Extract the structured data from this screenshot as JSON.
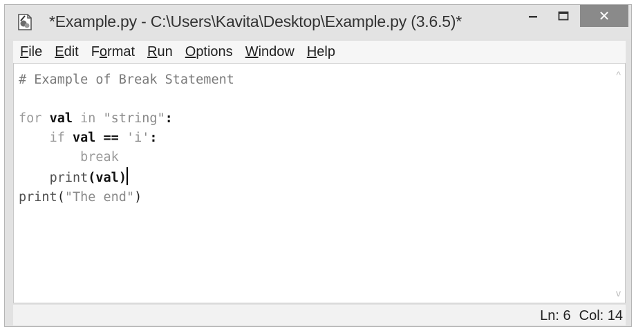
{
  "window": {
    "title": "*Example.py - C:\\Users\\Kavita\\Desktop\\Example.py (3.6.5)*",
    "app_icon": "idle-python-icon",
    "controls": {
      "minimize": "–",
      "maximize": "☐",
      "close": "✕"
    }
  },
  "menu": [
    {
      "pre": "",
      "u": "F",
      "post": "ile"
    },
    {
      "pre": "",
      "u": "E",
      "post": "dit"
    },
    {
      "pre": "F",
      "u": "o",
      "post": "rmat"
    },
    {
      "pre": "",
      "u": "R",
      "post": "un"
    },
    {
      "pre": "",
      "u": "O",
      "post": "ptions"
    },
    {
      "pre": "",
      "u": "W",
      "post": "indow"
    },
    {
      "pre": "",
      "u": "H",
      "post": "elp"
    }
  ],
  "editor": {
    "line1": "# Example of Break Statement",
    "line3": {
      "kw_for": "for",
      "var": "val",
      "kw_in": "in",
      "str": "\"string\"",
      "colon": ":"
    },
    "line4": {
      "indent": "    ",
      "kw_if": "if",
      "var": "val",
      "op": "==",
      "str": "'i'",
      "colon": ":"
    },
    "line5": {
      "indent": "        ",
      "kw": "break"
    },
    "line6": {
      "indent": "    ",
      "fn": "print",
      "args": "(val)"
    },
    "line7": {
      "fn": "print",
      "open": "(",
      "str": "\"The end\"",
      "close": ")"
    }
  },
  "scrollbar": {
    "up": "^",
    "down": "v"
  },
  "status": {
    "line": "Ln: 6",
    "col": "Col: 14"
  }
}
